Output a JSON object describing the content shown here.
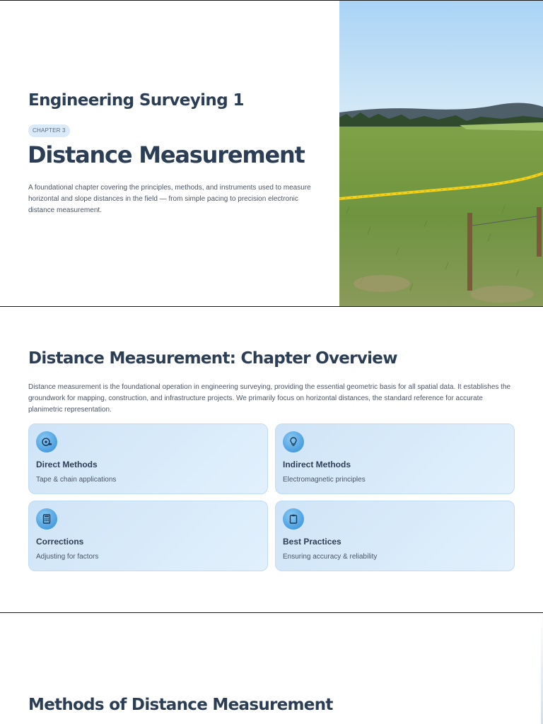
{
  "slide1": {
    "course_title": "Engineering Surveying 1",
    "chapter_badge": "CHAPTER 3",
    "chapter_title": "Distance Measurement",
    "description": "A foundational chapter covering the principles, methods, and instruments used to measure horizontal and slope distances in the field — from simple pacing to precision electronic distance measurement.",
    "hero_image": "field-with-yellow-tape-and-stakes"
  },
  "slide2": {
    "title": "Distance Measurement: Chapter Overview",
    "description": "Distance measurement is the foundational operation in engineering surveying, providing the essential geometric basis for all spatial data. It establishes the groundwork for mapping, construction, and infrastructure projects. We primarily focus on horizontal distances, the standard reference for accurate planimetric representation.",
    "cards": [
      {
        "icon": "tape-measure-icon",
        "title": "Direct Methods",
        "subtitle": "Tape & chain applications"
      },
      {
        "icon": "lightbulb-icon",
        "title": "Indirect Methods",
        "subtitle": "Electromagnetic principles"
      },
      {
        "icon": "calculator-icon",
        "title": "Corrections",
        "subtitle": "Adjusting for factors"
      },
      {
        "icon": "clipboard-icon",
        "title": "Best Practices",
        "subtitle": "Ensuring accuracy & reliability"
      }
    ]
  },
  "slide3": {
    "title": "Methods of Distance Measurement"
  },
  "colors": {
    "heading": "#2c3e55",
    "body_text": "#4a5566",
    "card_bg": "#d6e9f8",
    "icon_bg": "#4a9ee0",
    "badge_bg": "#dbeaf8"
  }
}
